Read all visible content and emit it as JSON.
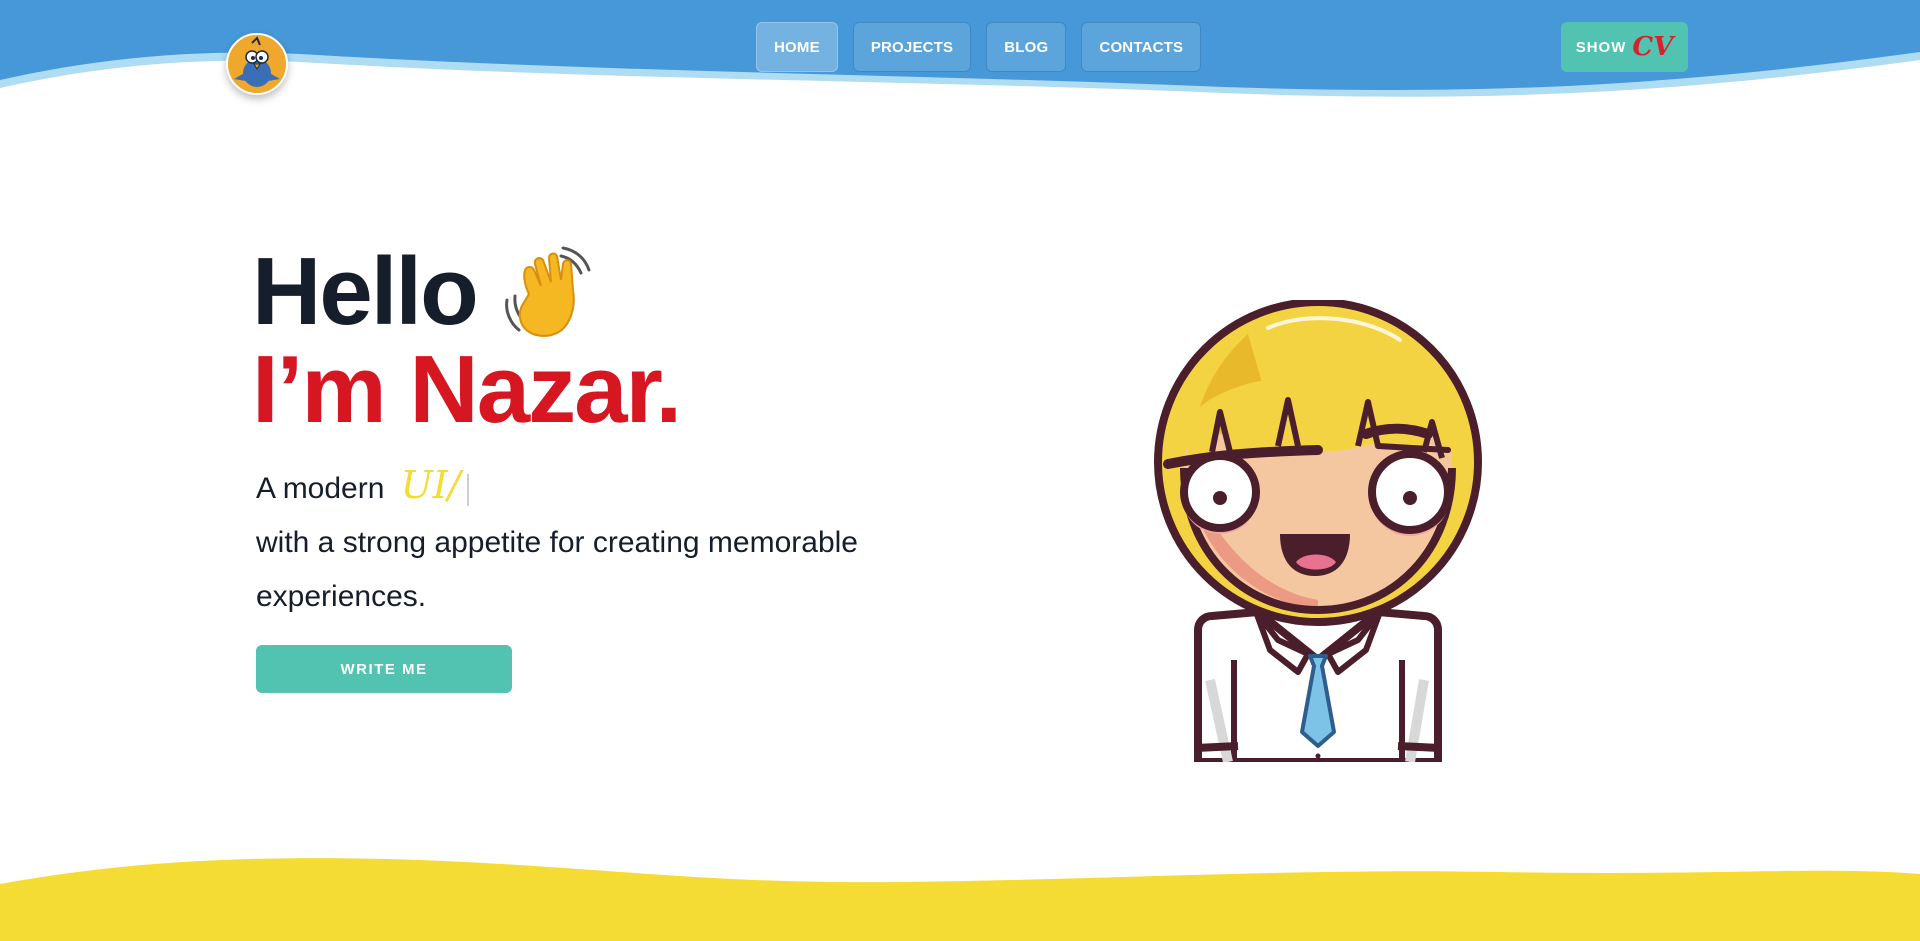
{
  "header": {
    "logo_icon": "bird-logo-icon",
    "nav": [
      {
        "label": "HOME",
        "active": true
      },
      {
        "label": "PROJECTS",
        "active": false
      },
      {
        "label": "BLOG",
        "active": false
      },
      {
        "label": "CONTACTS",
        "active": false
      }
    ],
    "cv_button": {
      "prefix": "SHOW",
      "highlight": "CV"
    }
  },
  "hero": {
    "greeting": "Hello",
    "wave_icon": "waving-hand-icon",
    "name_line": "I’m Nazar.",
    "subtitle_prefix": "A modern",
    "typed_word": "UI/",
    "subtitle_rest": "with a strong appetite for creating memorable experiences.",
    "cta_label": "WRITE ME",
    "avatar_icon": "cartoon-avatar-icon"
  },
  "colors": {
    "header_blue": "#4698d8",
    "accent_teal": "#51c3b0",
    "name_red": "#d61722",
    "footer_yellow": "#f4dc35",
    "text_dark": "#161d2b"
  }
}
